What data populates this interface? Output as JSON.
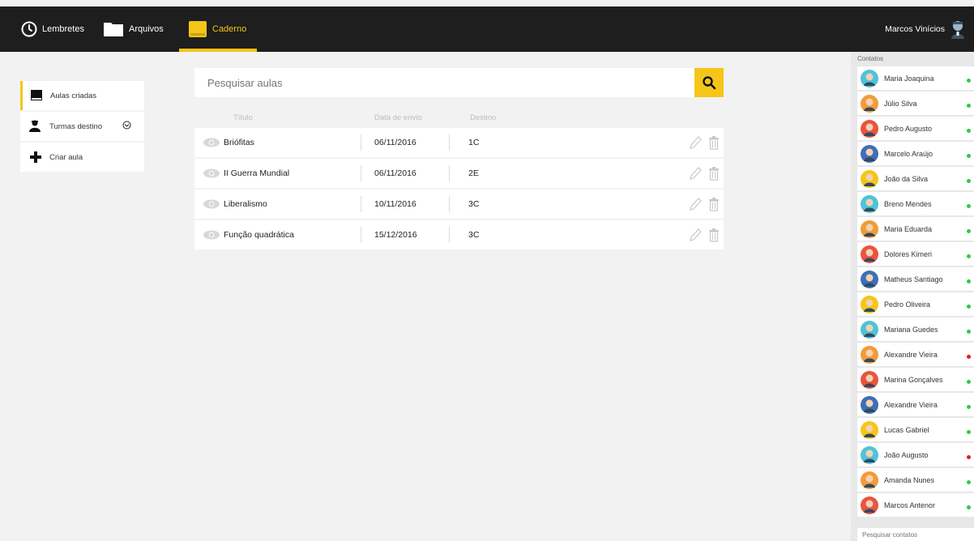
{
  "topbar": {
    "nav": [
      {
        "label": "Lembretes",
        "icon": "clock-icon"
      },
      {
        "label": "Arquivos",
        "icon": "folder-icon"
      },
      {
        "label": "Caderno",
        "icon": "notebook-icon"
      }
    ],
    "user": {
      "name": "Marcos Vinícios",
      "icon": "user-avatar"
    }
  },
  "colors": {
    "accent": "#f5c518",
    "topbar": "#1e1e1e",
    "online": "#2ecc40",
    "offline": "#e02020"
  },
  "sidebar": {
    "items": [
      {
        "label": "Aulas criadas",
        "icon": "book-icon"
      },
      {
        "label": "Turmas destino",
        "icon": "users-icon"
      },
      {
        "label": "Criar aula",
        "icon": "plus-icon"
      }
    ]
  },
  "search": {
    "placeholder": "Pesquisar aulas"
  },
  "table": {
    "headers": {
      "title": "Título",
      "date": "Data de envio",
      "dest": "Destino"
    },
    "rows": [
      {
        "title": "Briófitas",
        "date": "06/11/2016",
        "dest": "1C"
      },
      {
        "title": "II Guerra Mundial",
        "date": "06/11/2016",
        "dest": "2E"
      },
      {
        "title": "Liberalismo",
        "date": "10/11/2016",
        "dest": "3C"
      },
      {
        "title": "Função quadrática",
        "date": "15/12/2016",
        "dest": "3C"
      }
    ]
  },
  "contacts": {
    "header": "Contatos",
    "search_placeholder": "Pesquisar contatos",
    "list": [
      {
        "name": "Maria Joaquina",
        "status": "online"
      },
      {
        "name": "Júlio Silva",
        "status": "online"
      },
      {
        "name": "Pedro Augusto",
        "status": "online"
      },
      {
        "name": "Marcelo Araújo",
        "status": "online"
      },
      {
        "name": "João da Silva",
        "status": "online"
      },
      {
        "name": "Breno Mendes",
        "status": "online"
      },
      {
        "name": "Maria Eduarda",
        "status": "online"
      },
      {
        "name": "Dolores Kimeri",
        "status": "online"
      },
      {
        "name": "Matheus Santiago",
        "status": "online"
      },
      {
        "name": "Pedro Oliveira",
        "status": "online"
      },
      {
        "name": "Mariana Guedes",
        "status": "online"
      },
      {
        "name": "Alexandre Vieira",
        "status": "offline"
      },
      {
        "name": "Marina Gonçalves",
        "status": "online"
      },
      {
        "name": "Alexandre Vieira",
        "status": "online"
      },
      {
        "name": "Lucas Gabriel",
        "status": "online"
      },
      {
        "name": "João Augusto",
        "status": "offline"
      },
      {
        "name": "Amanda Nunes",
        "status": "online"
      },
      {
        "name": "Marcos Antenor",
        "status": "online"
      }
    ]
  }
}
